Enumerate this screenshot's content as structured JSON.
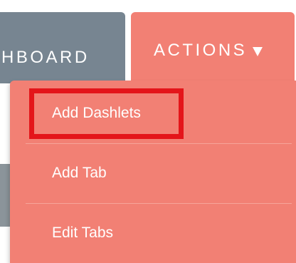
{
  "nav": {
    "dashboard_tab_label": "HBOARD",
    "actions_tab_label": "ACTIONS",
    "actions_caret_icon": "caret-down-icon"
  },
  "actions_menu": {
    "items": [
      {
        "label": "Add Dashlets",
        "highlighted": true
      },
      {
        "label": "Add Tab",
        "highlighted": false
      },
      {
        "label": "Edit Tabs",
        "highlighted": false
      }
    ]
  },
  "colors": {
    "dashboard_tab": "#778591",
    "actions_tab": "#f28074",
    "menu_background": "#f28074",
    "highlight_border": "#e4151a",
    "text": "#ffffff"
  }
}
